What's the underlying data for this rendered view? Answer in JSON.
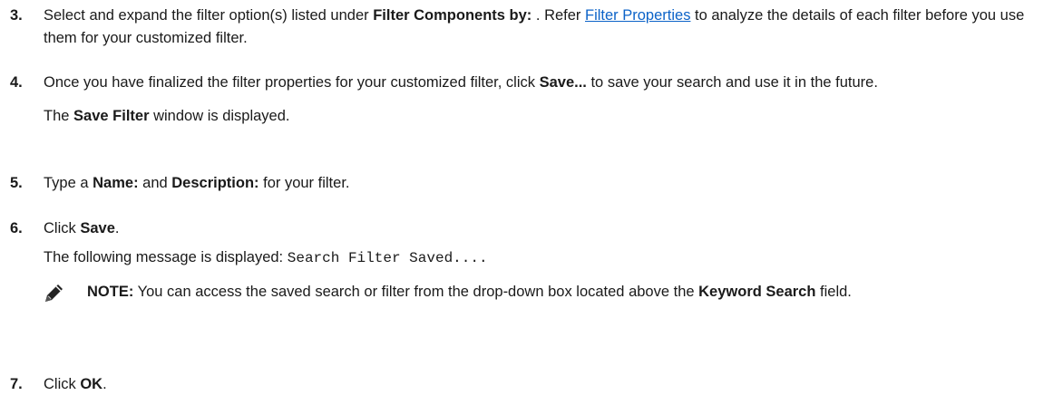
{
  "steps": [
    {
      "number": "3.",
      "segments": [
        "Select and expand the filter option(s) listed under ",
        "Filter Components by:",
        " . Refer ",
        "Filter Properties",
        " to analyze the details of each filter before you use them for your customized filter."
      ]
    },
    {
      "number": "4.",
      "segments": [
        "Once you have finalized the filter properties for your customized filter, click ",
        "Save...",
        " to save your search and use it in the future."
      ],
      "sub": [
        "The ",
        "Save Filter",
        " window is displayed."
      ]
    },
    {
      "number": "5.",
      "segments": [
        "Type a ",
        "Name:",
        " and ",
        "Description:",
        " for your filter."
      ]
    },
    {
      "number": "6.",
      "segments": [
        "Click ",
        "Save",
        "."
      ],
      "sub": [
        "The following message is displayed: ",
        "Search Filter Saved...."
      ],
      "note": {
        "icon": "pencil-note-icon",
        "label": "NOTE:",
        "segments": [
          " You can access the saved search or filter from the drop-down box located above the ",
          "Keyword Search",
          " field."
        ]
      }
    },
    {
      "number": "7.",
      "segments": [
        "Click ",
        "OK",
        "."
      ]
    }
  ],
  "colors": {
    "link": "#0c63c8",
    "text": "#1a1a1a"
  }
}
